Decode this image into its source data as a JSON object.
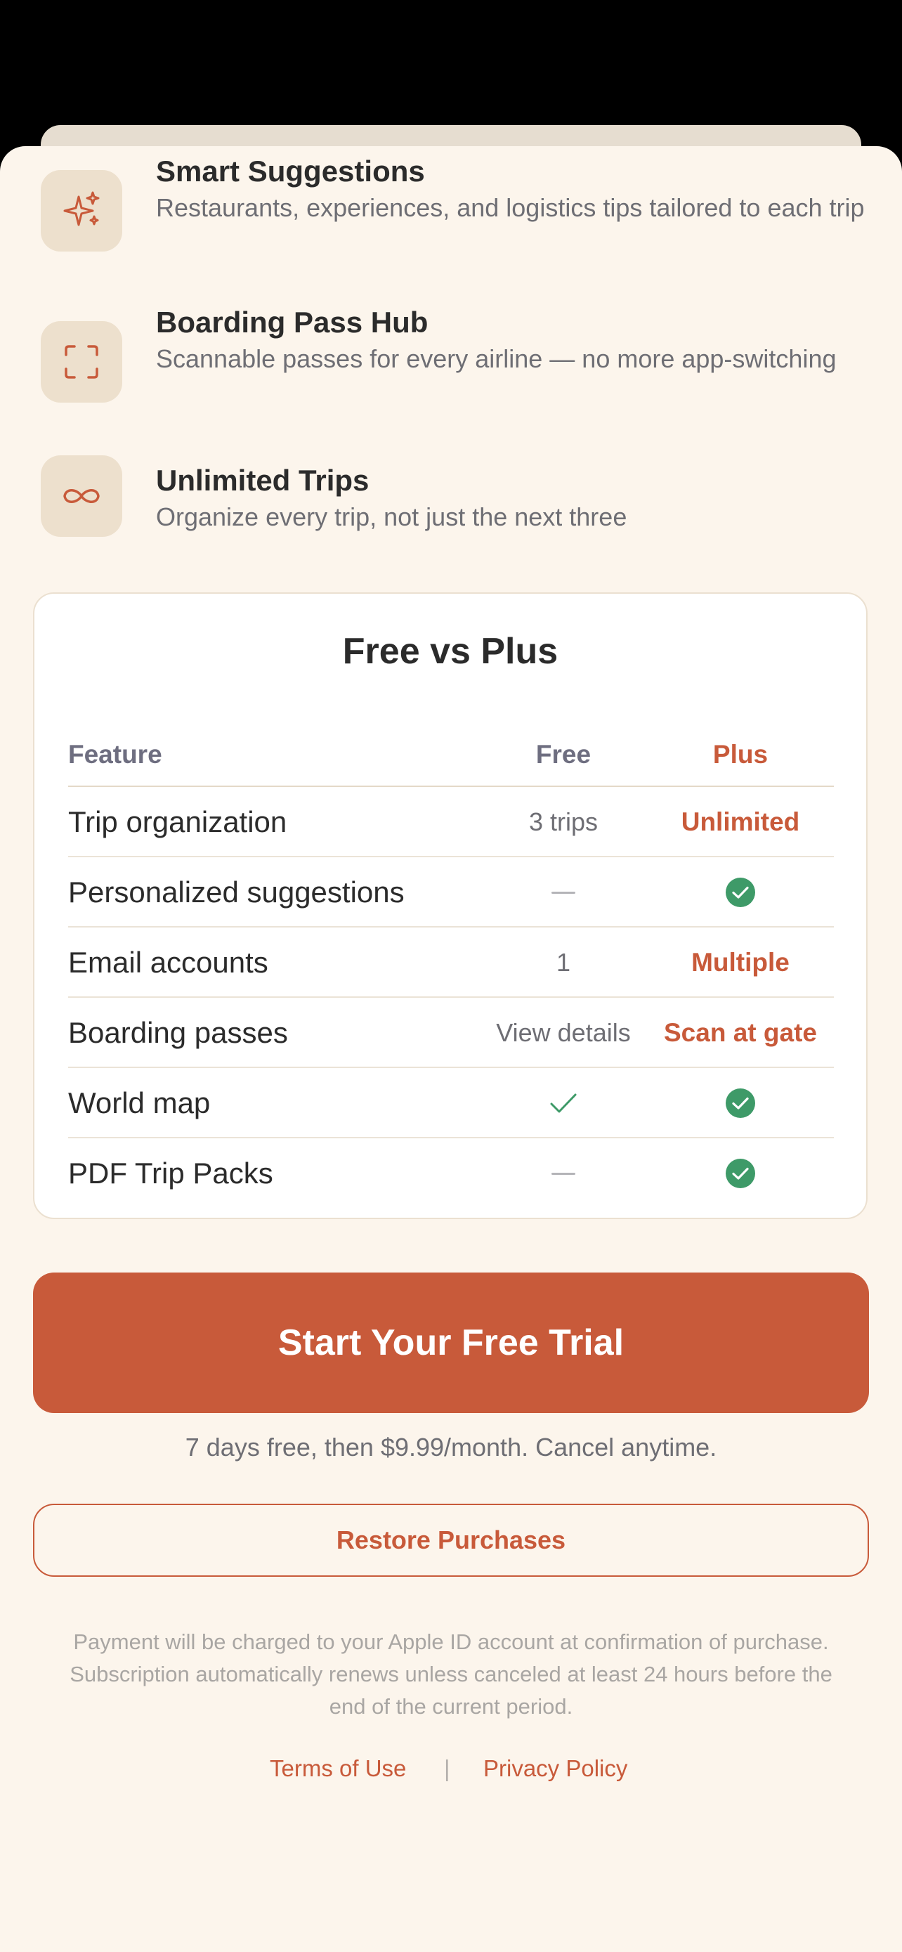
{
  "features": [
    {
      "title": "Smart Suggestions",
      "description": "Restaurants, experiences, and logistics tips tailored to each trip",
      "icon": "sparkles-icon"
    },
    {
      "title": "Boarding Pass Hub",
      "description": "Scannable passes for every airline — no more app-switching",
      "icon": "scan-frame-icon"
    },
    {
      "title": "Unlimited Trips",
      "description": "Organize every trip, not just the next three",
      "icon": "infinity-icon"
    }
  ],
  "comparison": {
    "title": "Free vs Plus",
    "headers": {
      "feature": "Feature",
      "free": "Free",
      "plus": "Plus"
    },
    "rows": [
      {
        "feature": "Trip organization",
        "free": "3 trips",
        "plus": "Unlimited"
      },
      {
        "feature": "Personalized suggestions",
        "free": "dash",
        "plus": "check-circle"
      },
      {
        "feature": "Email accounts",
        "free": "1",
        "plus": "Multiple"
      },
      {
        "feature": "Boarding passes",
        "free": "View details",
        "plus": "Scan at gate"
      },
      {
        "feature": "World map",
        "free": "checkmark",
        "plus": "check-circle"
      },
      {
        "feature": "PDF Trip Packs",
        "free": "dash",
        "plus": "check-circle"
      }
    ]
  },
  "cta": {
    "label": "Start Your Free Trial"
  },
  "trial_note": "7 days free, then $9.99/month. Cancel anytime.",
  "restore": {
    "label": "Restore Purchases"
  },
  "legal": "Payment will be charged to your Apple ID account at confirmation of purchase. Subscription automatically renews unless canceled at least 24 hours before the end of the current period.",
  "links": {
    "terms": "Terms of Use",
    "separator": "|",
    "privacy": "Privacy Policy"
  },
  "colors": {
    "accent": "#c85a3a",
    "success": "#3e9a68",
    "background": "#fcf5ec",
    "icon_tile": "#ede0cd"
  }
}
